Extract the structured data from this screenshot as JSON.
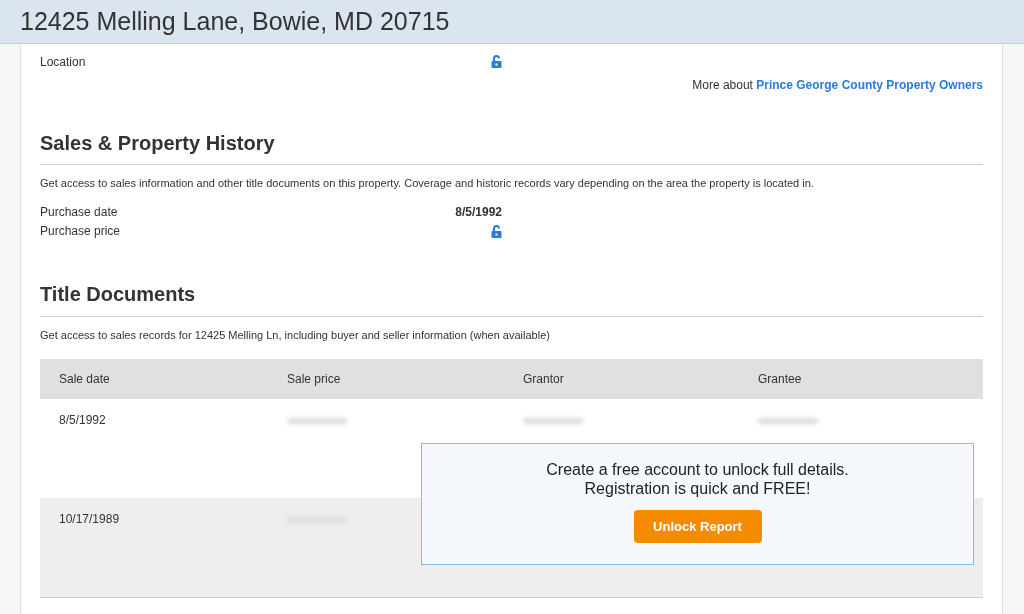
{
  "header": {
    "title": "12425 Melling Lane, Bowie, MD 20715"
  },
  "owner_rows": [
    {
      "label": "Location",
      "kind": "locked"
    }
  ],
  "more_about": {
    "text": "More about",
    "link": "Prince George County Property Owners"
  },
  "sales_history": {
    "heading": "Sales & Property History",
    "description": "Get access to sales information and other title documents on this property. Coverage and historic records vary depending on the area the property is located in.",
    "rows": [
      {
        "label": "Purchase date",
        "kind": "text",
        "value": "8/5/1992"
      },
      {
        "label": "Purchase price",
        "kind": "locked"
      }
    ]
  },
  "title_documents": {
    "heading": "Title Documents",
    "description": "Get access to sales records for 12425 Melling Ln, including buyer and seller information (when available)",
    "columns": [
      "Sale date",
      "Sale price",
      "Grantor",
      "Grantee"
    ],
    "rows": [
      {
        "cells": [
          {
            "kind": "text",
            "value": "8/5/1992"
          },
          {
            "kind": "blurred"
          },
          {
            "kind": "blurred"
          },
          {
            "kind": "blurred"
          }
        ]
      },
      {
        "cells": [
          {
            "kind": "text",
            "value": "10/17/1989"
          },
          {
            "kind": "blurred"
          }
        ]
      }
    ]
  },
  "unlock_panel": {
    "message_lines": [
      "Create a free account to unlock full details.",
      "Registration is quick and FREE!"
    ],
    "button": "Unlock Report"
  }
}
